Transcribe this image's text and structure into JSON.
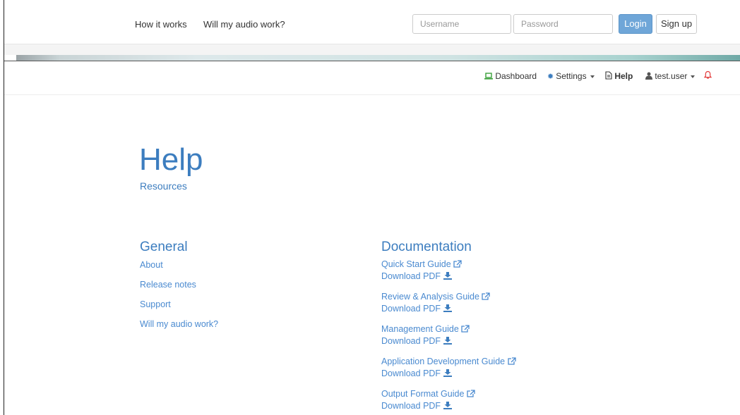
{
  "topbar": {
    "links": [
      "How it works",
      "Will my audio work?"
    ],
    "username_placeholder": "Username",
    "password_placeholder": "Password",
    "login_label": "Login",
    "signup_label": "Sign up"
  },
  "appnav": {
    "dashboard": "Dashboard",
    "settings": "Settings",
    "help": "Help",
    "user": "test.user"
  },
  "page": {
    "title": "Help",
    "subtitle": "Resources"
  },
  "general": {
    "heading": "General",
    "links": [
      "About",
      "Release notes",
      "Support",
      "Will my audio work?"
    ]
  },
  "documentation": {
    "heading": "Documentation",
    "download_label": "Download PDF",
    "guides": [
      "Quick Start Guide",
      "Review & Analysis Guide",
      "Management Guide",
      "Application Development Guide",
      "Output Format Guide"
    ]
  },
  "colors": {
    "accent": "#3c7dbf",
    "link": "#4a8ad0",
    "login_button": "#6fa6d8",
    "dashboard_icon": "#3aa03a",
    "settings_icon": "#3c7dbf",
    "bell_icon": "#e33b3b"
  },
  "icons": {
    "dashboard": "laptop-icon",
    "settings": "gear-icon",
    "help": "document-icon",
    "user": "user-icon",
    "notifications": "bell-icon",
    "external": "external-link-icon",
    "download": "download-icon"
  }
}
